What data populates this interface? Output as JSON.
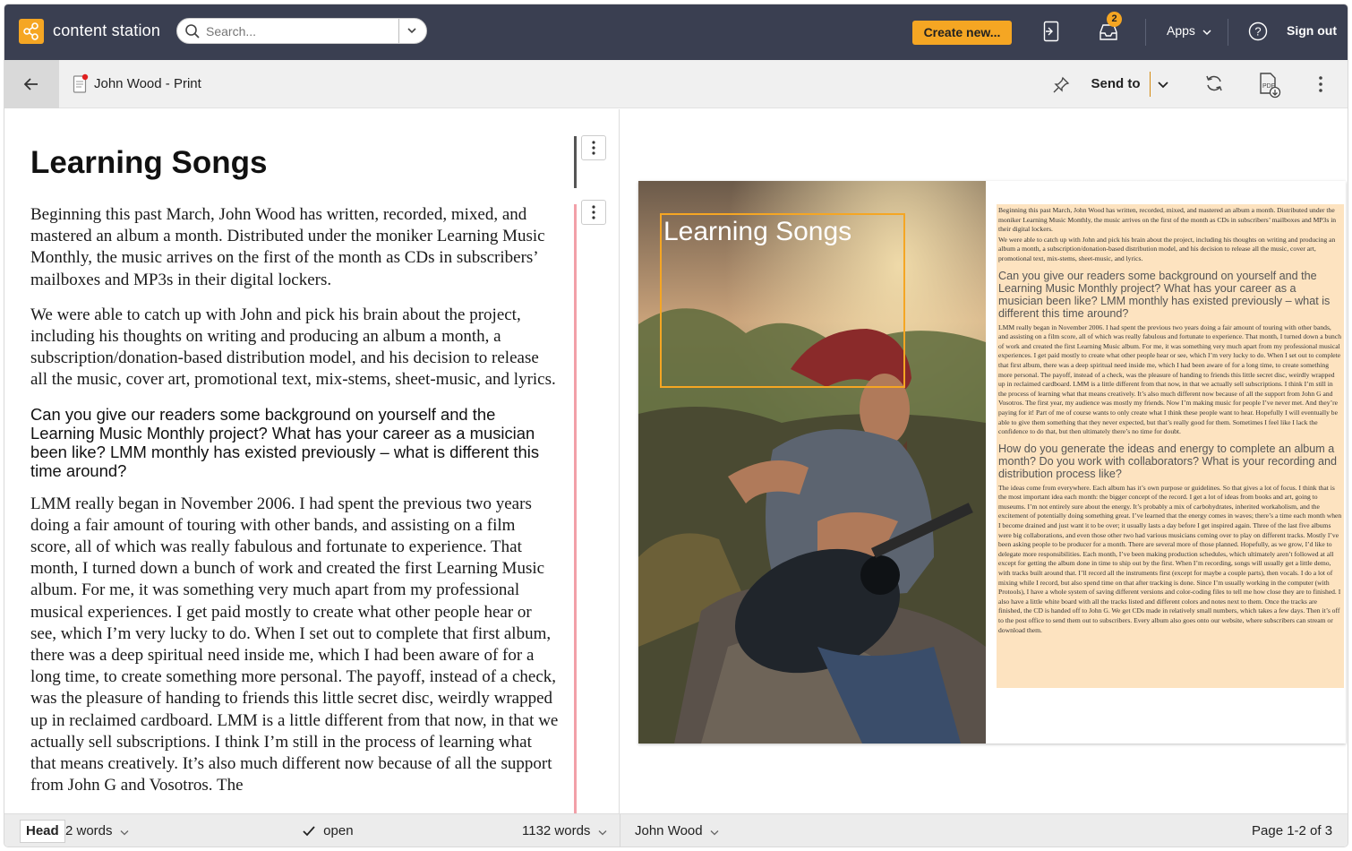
{
  "app": {
    "name": "content station"
  },
  "search": {
    "placeholder": "Search..."
  },
  "toolbar": {
    "create_label": "Create new...",
    "inbox_badge": "2",
    "apps_label": "Apps",
    "signout_label": "Sign out"
  },
  "document": {
    "title": "John Wood - Print",
    "send_to_label": "Send to"
  },
  "editor": {
    "heading": "Learning Songs",
    "paragraphs": [
      "Beginning this past March, John Wood has written, recorded, mixed, and mastered an album a month. Distributed under the moniker Learning Music Monthly, the music arrives on the first of the month as CDs in subscribers’ mailboxes and MP3s in their digital lockers.",
      "We were able to catch up with John and pick his brain about the project, including his thoughts on writing and producing an album a month, a subscription/donation-based distribution model, and his decision to release all the music, cover art, promotional text, mix-stems, sheet-music, and lyrics."
    ],
    "question1": "Can you give our readers some background on yourself and the Learning Music Monthly project? What has your career as a musician been like? LMM monthly has existed previously – what is different this time around?",
    "answer1": "LMM really began in November 2006. I had spent the previous two years doing a fair amount of touring with other bands, and assisting on a film score, all of which was really fabulous and fortunate to experience. That month, I turned down a bunch of work and created the first Learning Music album. For me, it was something very much apart from my professional musical experiences. I get paid mostly to create what other people hear or see, which I’m very lucky to do. When I set out to complete that first album, there was a deep spiritual need inside me, which I had been aware of for a long time, to create something more personal. The payoff, instead of a check, was the pleasure of handing to friends this little secret disc, weirdly wrapped up in reclaimed cardboard. LMM is a little different from that now, in that we actually sell subscriptions. I think I’m still in the process of learning what that means creatively. It’s also much different now because of all the support from John G and Vosotros. The"
  },
  "preview": {
    "photo_title": "Learning Songs",
    "col_p1": "Beginning this past March, John Wood has written, recorded, mixed, and mastered an album a month. Distributed under the moniker Learning Music Monthly, the music arrives on the first of the month as CDs in subscribers’ mailboxes and MP3s in their digital lockers.",
    "col_p2": "We were able to catch up with John and pick his brain about the project, including his thoughts on writing and producing an album a month, a subscription/donation-based distribution model, and his decision to release all the music, cover art, promotional text, mix-stems, sheet-music, and lyrics.",
    "col_q1": "Can you give our readers some background on yourself and the Learning Music Monthly project? What has your career as a musician been like? LMM monthly has existed previously – what is different this time around?",
    "col_a1": "LMM really began in November 2006. I had spent the previous two years doing a fair amount of touring with other bands, and assisting on a film score, all of which was really fabulous and fortunate to experience. That month, I turned down a bunch of work and created the first Learning Music album. For me, it was something very much apart from my professional musical experiences. I get paid mostly to create what other people hear or see, which I’m very lucky to do. When I set out to complete that first album, there was a deep spiritual need inside me, which I had been aware of for a long time, to create something more personal. The payoff, instead of a check, was the pleasure of handing to friends this little secret disc, weirdly wrapped up in reclaimed cardboard. LMM is a little different from that now, in that we actually sell subscriptions. I think I’m still in the process of learning what that means creatively. It’s also much different now because of all the support from John G and Vosotros. The first year, my audience was mostly my friends. Now I’m making music for people I’ve never met. And they’re paying for it! Part of me of course wants to only create what I think these people want to hear. Hopefully I will eventually be able to give them something that they never expected, but that’s really good for them. Sometimes I feel like I lack the confidence to do that, but then ultimately there’s no time for doubt.",
    "col_q2": "How do you generate the ideas and energy to complete an album a month? Do you work with collaborators? What is your recording and distribution process like?",
    "col_a2": "The ideas come from everywhere. Each album has it’s own purpose or guidelines. So that gives a lot of focus. I think that is the most important idea each month: the bigger concept of the record. I get a lot of ideas from books and art, going to museums. I’m not entirely sure about the energy. It’s probably a mix of carbohydrates, inherited workaholism, and the excitement of potentially doing something great. I’ve learned that the energy comes in waves; there’s a time each month when I become drained and just want it to be over; it usually lasts a day before I get inspired again. Three of the last five albums were big collaborations, and even those other two had various musicians coming over to play on different tracks. Mostly I’ve been asking people to be producer for a month. There are several more of those planned. Hopefully, as we grow, I’d like to delegate more responsibilities. Each month, I’ve been making production schedules, which ultimately aren’t followed at all except for getting the album done in time to ship out by the first. When I’m recording, songs will usually get a little demo, with tracks built around that. I’ll record all the instruments first (except for maybe a couple parts), then vocals. I do a lot of mixing while I record, but also spend time on that after tracking is done. Since I’m usually working in the computer (with Protools), I have a whole system of saving different versions and color-coding files to tell me how close they are to finished. I also have a little white board with all the tracks listed and different colors and notes next to them. Once the tracks are finished, the CD is handed off to John G. We get CDs made in relatively small numbers, which takes a few days. Then it’s off to the post office to send them out to subscribers. Every album also goes onto our website, where subscribers can stream or download them."
  },
  "status": {
    "style_label": "Head",
    "selection_words": "2 words",
    "state_label": "open",
    "total_words": "1132 words",
    "author": "John Wood",
    "page_label": "Page 1-2 of 3"
  },
  "colors": {
    "topbar": "#3a3f51",
    "accent": "#f5a623",
    "highlight": "#fde3c0",
    "rail": "#f2a0a8"
  }
}
